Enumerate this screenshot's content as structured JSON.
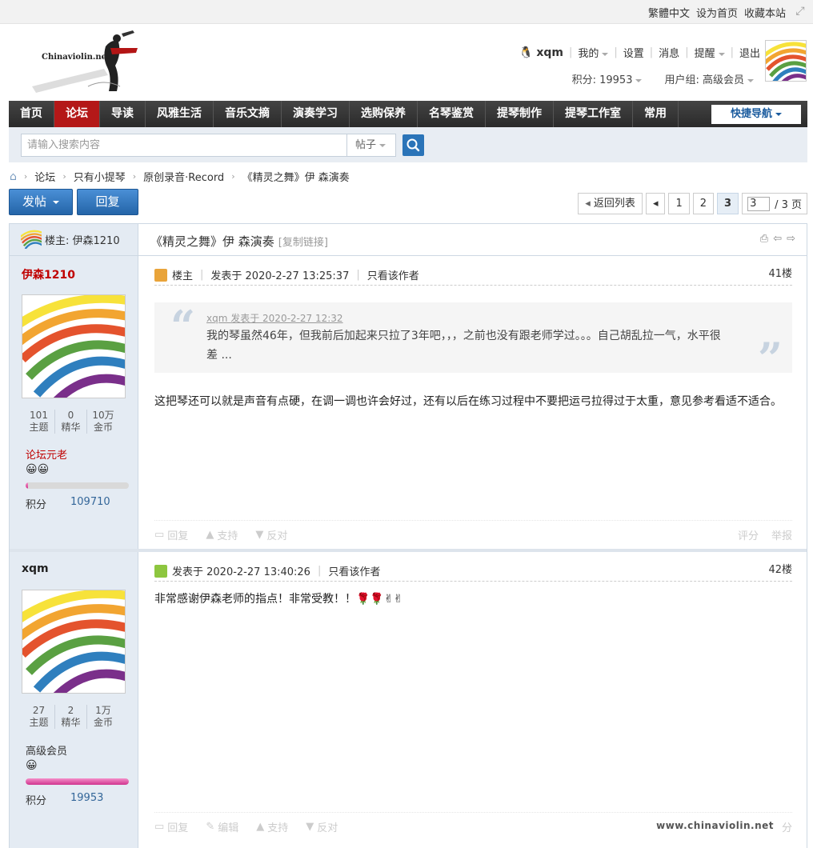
{
  "topbar": {
    "links": [
      "繁體中文",
      "设为首页",
      "收藏本站"
    ]
  },
  "logo": {
    "text": "Chinaviolin.net"
  },
  "user": {
    "name": "xqm",
    "menu": [
      "我的",
      "设置",
      "消息",
      "提醒",
      "退出"
    ],
    "points_label": "积分: 19953",
    "group_label": "用户组: 高级会员"
  },
  "nav": {
    "items": [
      "首页",
      "论坛",
      "导读",
      "风雅生活",
      "音乐文摘",
      "演奏学习",
      "选购保养",
      "名琴鉴赏",
      "提琴制作",
      "提琴工作室",
      "常用"
    ],
    "active_index": 1,
    "quick": "快捷导航"
  },
  "search": {
    "placeholder": "请输入搜索内容",
    "type": "帖子"
  },
  "breadcrumb": [
    "论坛",
    "只有小提琴",
    "原创录音·Record",
    "《精灵之舞》伊 森演奏"
  ],
  "buttons": {
    "post": "发帖",
    "reply": "回复"
  },
  "pager": {
    "back": "返回列表",
    "pages": [
      "1",
      "2",
      "3"
    ],
    "current": "3",
    "input": "3",
    "total": "/ 3 页"
  },
  "thread": {
    "host_label": "楼主: 伊森1210",
    "subject": "《精灵之舞》伊 森演奏",
    "copy_link": "[复制链接]"
  },
  "posts": [
    {
      "author": "伊森1210",
      "author_color": "#c00000",
      "stats": [
        {
          "value": "101",
          "label": "主题"
        },
        {
          "value": "0",
          "label": "精华"
        },
        {
          "value": "10万",
          "label": "金币"
        }
      ],
      "rank": "论坛元老",
      "rank_color": "#c00000",
      "emoji": "😀😀",
      "progress": 0.02,
      "points_label": "积分",
      "points_value": "109710",
      "is_host_label": "楼主",
      "posted": "发表于 2020-2-27 13:25:37",
      "only_author": "只看该作者",
      "floor": "41楼",
      "quote_head": "xqm 发表于 2020-2-27 12:32",
      "quote_body": "我的琴虽然46年，但我前后加起来只拉了3年吧，，，之前也没有跟老师学过。。。自己胡乱拉一气，水平很差 ...",
      "content": "这把琴还可以就是声音有点硬，在调一调也许会好过，还有以后在练习过程中不要把运弓拉得过于太重，意见参考看适不适合。",
      "actions": [
        "回复",
        "支持",
        "反对"
      ],
      "actions_right": [
        "评分",
        "举报"
      ]
    },
    {
      "author": "xqm",
      "author_color": "#222222",
      "stats": [
        {
          "value": "27",
          "label": "主题"
        },
        {
          "value": "2",
          "label": "精华"
        },
        {
          "value": "1万",
          "label": "金币"
        }
      ],
      "rank": "高级会员",
      "rank_color": "#333333",
      "emoji": "😀",
      "progress": 1.0,
      "points_label": "积分",
      "points_value": "19953",
      "posted": "发表于 2020-2-27 13:40:26",
      "only_author": "只看该作者",
      "floor": "42楼",
      "content": "非常感谢伊森老师的指点！非常受教！！🌹🌹✌✌",
      "actions": [
        "回复",
        "编辑",
        "支持",
        "反对"
      ],
      "actions_right": [
        "分"
      ]
    }
  ],
  "watermark": "www.chinaviolin.net",
  "colors": {
    "nav_active": "#b41818",
    "link_blue": "#2b74b8",
    "accent_red": "#c00000"
  }
}
